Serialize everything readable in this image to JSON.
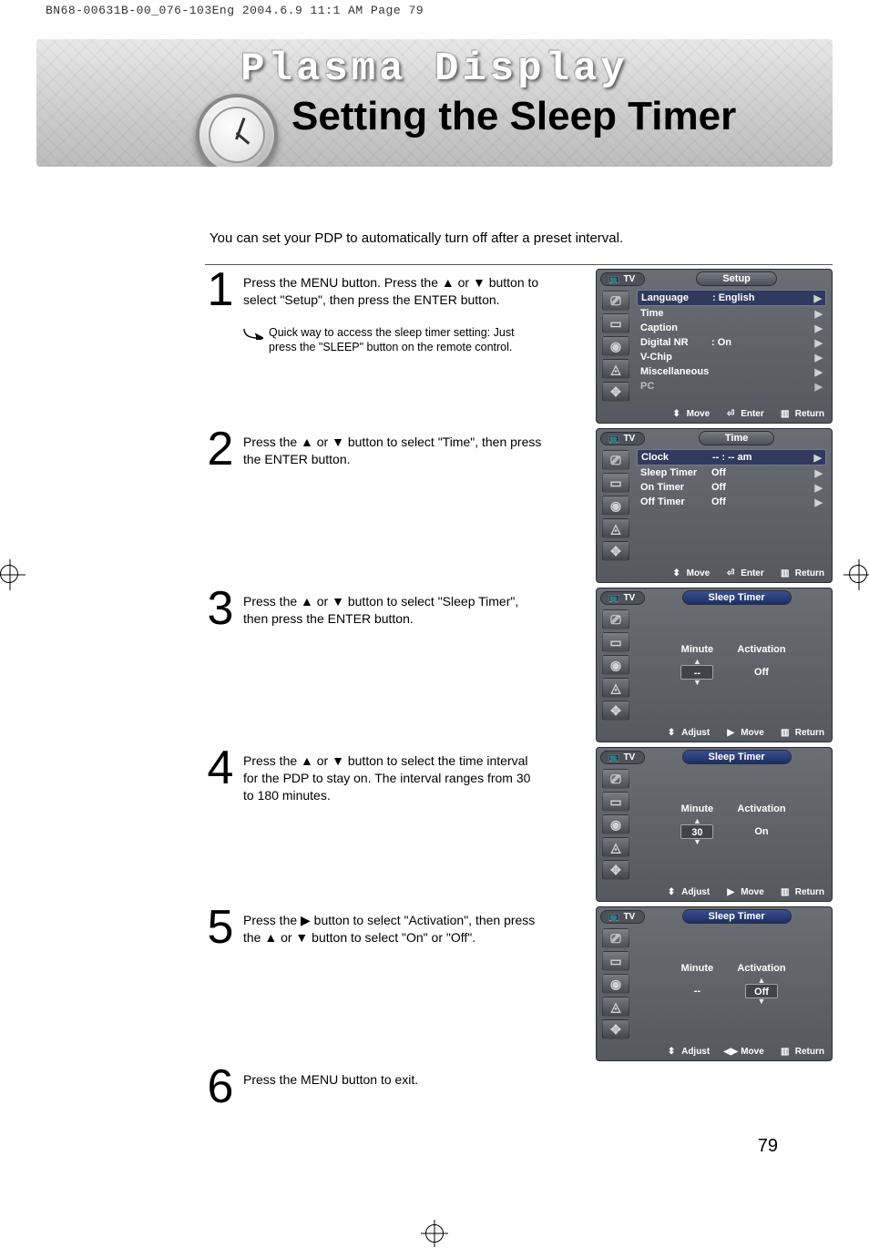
{
  "print": {
    "header": "BN68-00631B-00_076-103Eng  2004.6.9  11:1 AM  Page 79"
  },
  "banner": {
    "brand": "Plasma Display",
    "title": "Setting the Sleep Timer"
  },
  "intro": "You can set your PDP to automatically turn off after a preset interval.",
  "page_number": "79",
  "steps": [
    {
      "num": "1",
      "text": "Press the MENU button. Press the ▲ or ▼ button to select \"Setup\", then press the ENTER button.",
      "tip": "Quick way to access the sleep timer setting: Just press the \"SLEEP\" button on the remote control."
    },
    {
      "num": "2",
      "text": "Press the ▲ or ▼ button to select \"Time\", then press the ENTER button."
    },
    {
      "num": "3",
      "text": "Press the ▲ or ▼ button to select \"Sleep Timer\", then press the ENTER button."
    },
    {
      "num": "4",
      "text": "Press the ▲ or ▼ button to select the time interval for the PDP to stay on. The interval ranges from 30 to 180 minutes."
    },
    {
      "num": "5",
      "text": "Press the ▶ button to select \"Activation\", then press the ▲ or ▼ button to select \"On\" or \"Off\"."
    },
    {
      "num": "6",
      "text": "Press the MENU button to exit."
    }
  ],
  "osd_common": {
    "tv": "TV",
    "foot_move": "Move",
    "foot_enter": "Enter",
    "foot_return": "Return",
    "foot_adjust": "Adjust"
  },
  "osd1": {
    "title": "Setup",
    "rows": [
      {
        "label": "Language",
        "val": ":  English",
        "sel": true
      },
      {
        "label": "Time",
        "val": ""
      },
      {
        "label": "Caption",
        "val": ""
      },
      {
        "label": "Digital NR",
        "val": ":  On"
      },
      {
        "label": "V-Chip",
        "val": ""
      },
      {
        "label": "Miscellaneous",
        "val": ""
      },
      {
        "label": "PC",
        "val": "",
        "dim": true
      }
    ]
  },
  "osd2": {
    "title": "Time",
    "rows": [
      {
        "label": "Clock",
        "val": "-- : -- am",
        "sel": true
      },
      {
        "label": "Sleep Timer",
        "val": "Off"
      },
      {
        "label": "On Timer",
        "val": "Off"
      },
      {
        "label": "Off Timer",
        "val": "Off"
      }
    ]
  },
  "osd3": {
    "title": "Sleep Timer",
    "col1_label": "Minute",
    "col2_label": "Activation",
    "col1_val": "--",
    "col2_val": "Off",
    "focus": "minute",
    "foot_mid_icon": "right"
  },
  "osd4": {
    "title": "Sleep Timer",
    "col1_label": "Minute",
    "col2_label": "Activation",
    "col1_val": "30",
    "col2_val": "On",
    "focus": "minute",
    "foot_mid_icon": "right"
  },
  "osd5": {
    "title": "Sleep Timer",
    "col1_label": "Minute",
    "col2_label": "Activation",
    "col1_val": "--",
    "col2_val": "Off",
    "focus": "activation",
    "foot_mid_icon": "lr"
  }
}
